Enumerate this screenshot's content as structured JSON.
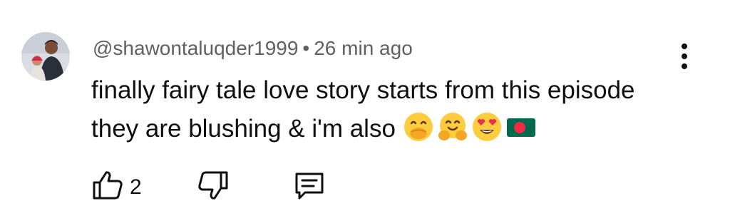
{
  "comment": {
    "author": "@shawontaluqder1999",
    "separator": "•",
    "time": "26 min ago",
    "line1": "finally fairy tale love story starts from this episode",
    "line2": "they are blushing & i'm also",
    "emojis": [
      "face-with-hand-over-mouth",
      "hugging-face",
      "smiling-face-with-heart-eyes",
      "bangladesh-flag"
    ],
    "likes": "2"
  },
  "icons": {
    "menu": "more-vertical-icon",
    "like": "thumbs-up-icon",
    "dislike": "thumbs-down-icon",
    "reply": "comment-icon"
  },
  "colors": {
    "text": "#0f0f0f",
    "meta": "#606060",
    "flag_green": "#006a4e",
    "flag_red": "#f42a41",
    "emoji_yellow": "#ffcc3d"
  }
}
